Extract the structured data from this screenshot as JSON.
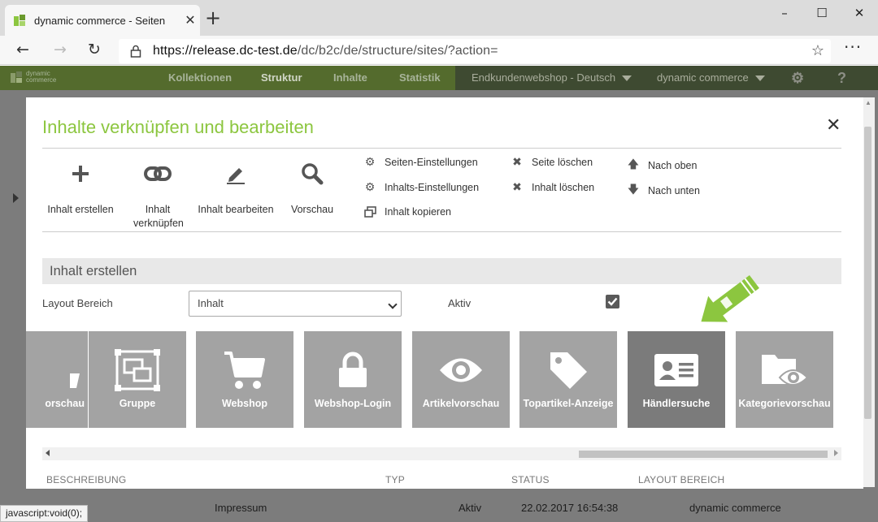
{
  "browser": {
    "tab_title": "dynamic commerce - Seiten",
    "url_host": "https://release.dc-test.de",
    "url_path": "/dc/b2c/de/structure/sites/?action=",
    "status_text": "javascript:void(0);"
  },
  "app": {
    "logo_text": "dynamic commerce",
    "nav": [
      {
        "label": "Kollektionen"
      },
      {
        "label": "Struktur",
        "selected": true
      },
      {
        "label": "Inhalte"
      },
      {
        "label": "Statistik"
      }
    ],
    "shop_select": "Endkundenwebshop - Deutsch",
    "company_select": "dynamic commerce",
    "help": "?"
  },
  "modal": {
    "title": "Inhalte verknüpfen und bearbeiten",
    "toolbar": [
      {
        "label": "Inhalt erstellen",
        "icon": "plus-icon"
      },
      {
        "label": "Inhalt verknüpfen",
        "icon": "link-icon"
      },
      {
        "label": "Inhalt bearbeiten",
        "icon": "pencil-icon"
      },
      {
        "label": "Vorschau",
        "icon": "search-icon"
      }
    ],
    "actions": {
      "site_settings": "Seiten-Einstellungen",
      "content_settings": "Inhalts-Einstellungen",
      "copy_content": "Inhalt kopieren",
      "delete_site": "Seite löschen",
      "delete_content": "Inhalt löschen",
      "move_up": "Nach oben",
      "move_down": "Nach unten"
    },
    "section_title": "Inhalt erstellen",
    "layout_label": "Layout Bereich",
    "layout_value": "Inhalt",
    "active_label": "Aktiv",
    "active_checked": true,
    "tiles": [
      {
        "label": "orschau",
        "icon": "partial-icon"
      },
      {
        "label": "Gruppe",
        "icon": "group-icon"
      },
      {
        "label": "Webshop",
        "icon": "cart-icon"
      },
      {
        "label": "Webshop-Login",
        "icon": "lock-icon"
      },
      {
        "label": "Artikelvorschau",
        "icon": "eye-icon"
      },
      {
        "label": "Topartikel-Anzeige",
        "icon": "tag-icon"
      },
      {
        "label": "Händlersuche",
        "icon": "contact-card-icon",
        "highlighted": true
      },
      {
        "label": "Kategorievorschau",
        "icon": "folder-eye-icon"
      }
    ],
    "table_headers": [
      "BESCHREIBUNG",
      "TYP",
      "STATUS",
      "LAYOUT BEREICH"
    ]
  },
  "background_row": {
    "title": "Impressum",
    "status": "Aktiv",
    "date": "22.02.2017 16:54:38",
    "owner": "dynamic commerce"
  },
  "colors": {
    "accent_green": "#8cc63f",
    "header_green": "#546b2d",
    "tile_gray": "#a3a3a3",
    "tile_highlight": "#7b7b7b"
  }
}
